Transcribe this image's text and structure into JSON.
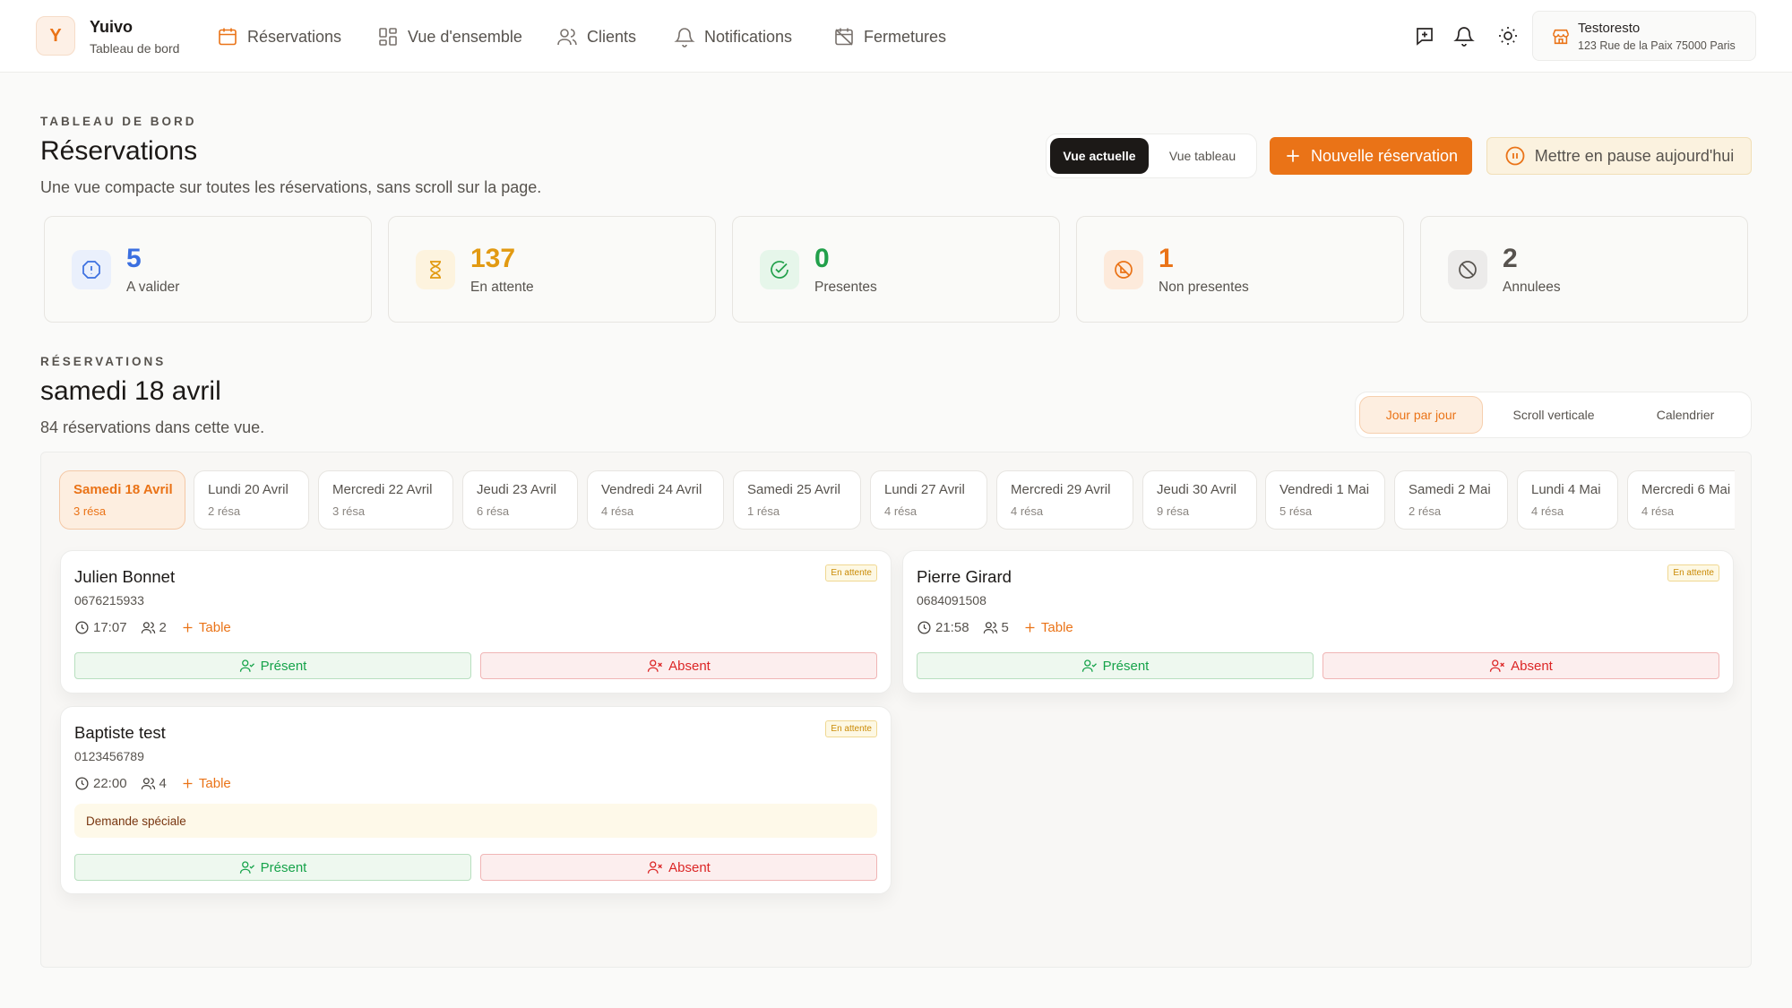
{
  "brand": {
    "initial": "Y",
    "name": "Yuivo",
    "subtitle": "Tableau de bord"
  },
  "nav": [
    {
      "label": "Réservations",
      "icon": "calendar-icon",
      "active": true
    },
    {
      "label": "Vue d'ensemble",
      "icon": "grid-icon"
    },
    {
      "label": "Clients",
      "icon": "users-icon"
    },
    {
      "label": "Notifications",
      "icon": "bell-icon"
    },
    {
      "label": "Fermetures",
      "icon": "calendar-off-icon"
    }
  ],
  "top_icons": [
    "message-plus-icon",
    "bell-icon",
    "sun-icon"
  ],
  "restaurant": {
    "name": "Testoresto",
    "address": "123 Rue de la Paix 75000 Paris",
    "icon": "store-icon"
  },
  "header": {
    "eyebrow": "TABLEAU DE BORD",
    "title": "Réservations",
    "description": "Une vue compacte sur toutes les réservations, sans scroll sur la page.",
    "view_toggle": {
      "options": [
        "Vue actuelle",
        "Vue tableau"
      ],
      "selected": "Vue actuelle"
    },
    "new_button": "Nouvelle réservation",
    "pause_button": "Mettre en pause aujourd'hui"
  },
  "stats": [
    {
      "value": "5",
      "label": "A valider",
      "icon": "alert-octagon-icon",
      "color": "#3b6fe0",
      "bg": "#eaf0fc"
    },
    {
      "value": "137",
      "label": "En attente",
      "icon": "hourglass-icon",
      "color": "#e29a12",
      "bg": "#fdf3de"
    },
    {
      "value": "0",
      "label": "Presentes",
      "icon": "check-circle-icon",
      "color": "#22a04b",
      "bg": "#e6f6ea"
    },
    {
      "value": "1",
      "label": "Non presentes",
      "icon": "no-show-icon",
      "color": "#ea7317",
      "bg": "#fdeadb"
    },
    {
      "value": "2",
      "label": "Annulees",
      "icon": "ban-icon",
      "color": "#57534e",
      "bg": "#ecebea"
    }
  ],
  "reservations": {
    "eyebrow": "RÉSERVATIONS",
    "title": "samedi 18 avril",
    "count_text": "84 réservations dans cette vue.",
    "mode_toggle": {
      "options": [
        "Jour par jour",
        "Scroll verticale",
        "Calendrier"
      ],
      "selected": "Jour par jour"
    },
    "days": [
      {
        "label": "Samedi 18 Avril",
        "count": "3 résa",
        "active": true
      },
      {
        "label": "Lundi 20 Avril",
        "count": "2 résa"
      },
      {
        "label": "Mercredi 22 Avril",
        "count": "3 résa"
      },
      {
        "label": "Jeudi 23 Avril",
        "count": "6 résa"
      },
      {
        "label": "Vendredi 24 Avril",
        "count": "4 résa"
      },
      {
        "label": "Samedi 25 Avril",
        "count": "1 résa"
      },
      {
        "label": "Lundi 27 Avril",
        "count": "4 résa"
      },
      {
        "label": "Mercredi 29 Avril",
        "count": "4 résa"
      },
      {
        "label": "Jeudi 30 Avril",
        "count": "9 résa"
      },
      {
        "label": "Vendredi 1 Mai",
        "count": "5 résa"
      },
      {
        "label": "Samedi 2 Mai",
        "count": "2 résa"
      },
      {
        "label": "Lundi 4 Mai",
        "count": "4 résa"
      },
      {
        "label": "Mercredi 6 Mai",
        "count": "4 résa"
      }
    ],
    "cards": [
      {
        "name": "Julien Bonnet",
        "phone": "0676215933",
        "time": "17:07",
        "guests": "2",
        "table_label": "Table",
        "status": "En attente",
        "present": "Présent",
        "absent": "Absent"
      },
      {
        "name": "Pierre Girard",
        "phone": "0684091508",
        "time": "21:58",
        "guests": "5",
        "table_label": "Table",
        "status": "En attente",
        "present": "Présent",
        "absent": "Absent"
      },
      {
        "name": "Baptiste test",
        "phone": "0123456789",
        "time": "22:00",
        "guests": "4",
        "table_label": "Table",
        "status": "En attente",
        "special_request": "Demande spéciale",
        "present": "Présent",
        "absent": "Absent"
      }
    ]
  },
  "colors": {
    "accent": "#ea7317",
    "present": "#16a34a",
    "absent": "#dc2626",
    "pending": "#ca8a04"
  }
}
